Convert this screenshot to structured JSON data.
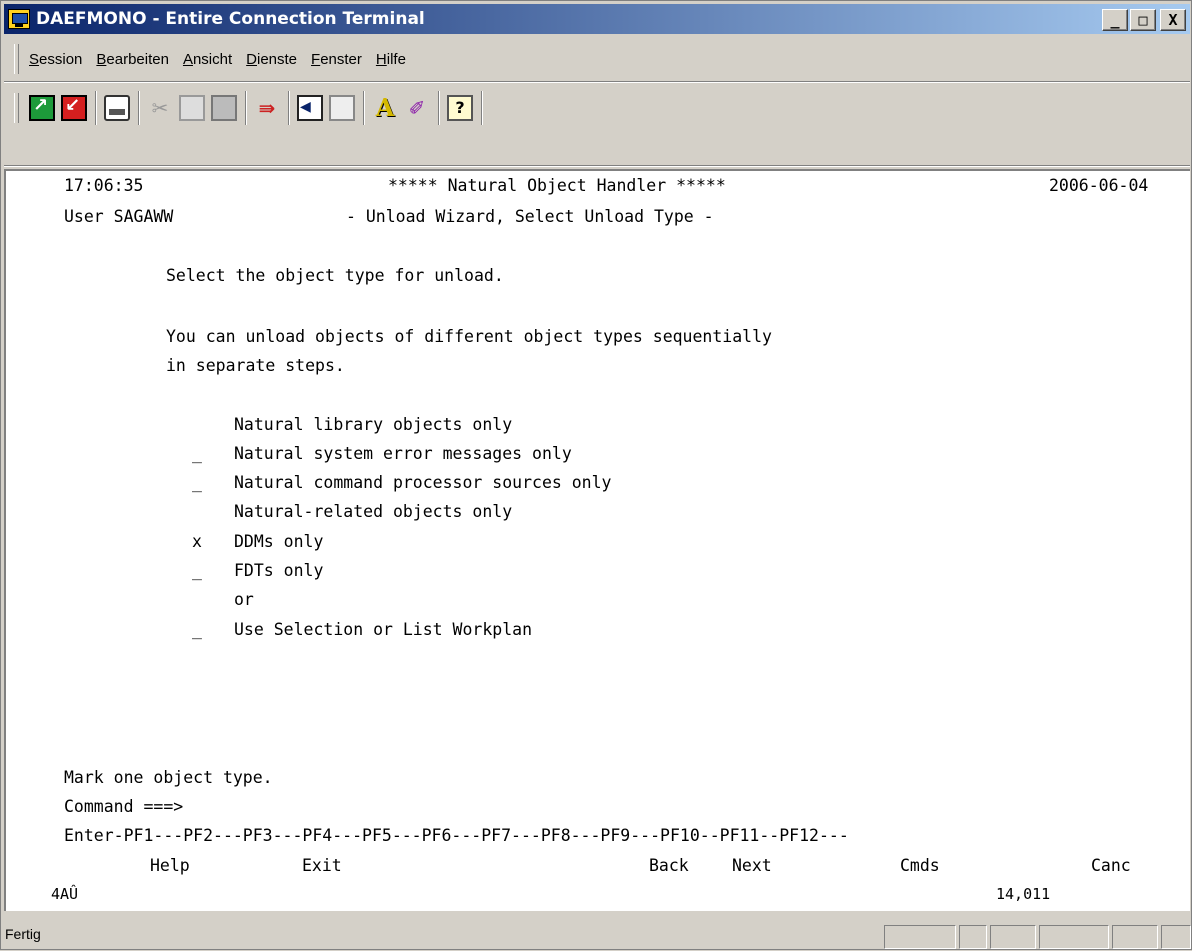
{
  "window": {
    "title": "DAEFMONO - Entire Connection Terminal",
    "minimize": "_",
    "maximize": "□",
    "close": "X"
  },
  "menu": {
    "items": [
      {
        "first": "S",
        "rest": "ession"
      },
      {
        "first": "B",
        "rest": "earbeiten"
      },
      {
        "first": "A",
        "rest": "nsicht"
      },
      {
        "first": "D",
        "rest": "ienste"
      },
      {
        "first": "F",
        "rest": "enster"
      },
      {
        "first": "H",
        "rest": "ilfe"
      }
    ]
  },
  "toolbar": {
    "icons": [
      "connect-icon",
      "disconnect-icon",
      "print-icon",
      "cut-icon",
      "copy-icon",
      "paste-icon",
      "transfer-icon",
      "send-icon",
      "receive-icon",
      "font-icon",
      "color-icon",
      "help-icon"
    ]
  },
  "terminal": {
    "time": "17:06:35",
    "header_title": "***** Natural Object Handler *****",
    "date": "2006-06-04",
    "user": "User SAGAWW",
    "subtitle": "- Unload Wizard, Select Unload Type -",
    "instruction1": "Select the object type for unload.",
    "instruction2": "You can unload objects of different object types sequentially",
    "instruction3": "in separate steps.",
    "options": [
      {
        "field": " ",
        "label": "Natural library objects only"
      },
      {
        "field": "_",
        "label": "Natural system error messages only"
      },
      {
        "field": "_",
        "label": "Natural command processor sources only"
      },
      {
        "field": " ",
        "label": "Natural-related objects only"
      },
      {
        "field": "x",
        "label": "DDMs only"
      },
      {
        "field": "_",
        "label": "FDTs only"
      },
      {
        "field": " ",
        "label": "or"
      },
      {
        "field": "_",
        "label": "Use Selection or List Workplan"
      }
    ],
    "message": "Mark one object type.",
    "command_prompt": "Command ===>",
    "pf_line": "Enter-PF1---PF2---PF3---PF4---PF5---PF6---PF7---PF8---PF9---PF10--PF11--PF12---",
    "pf_labels": {
      "help": "Help",
      "exit": "Exit",
      "back": "Back",
      "next": "Next",
      "cmds": "Cmds",
      "canc": "Canc"
    },
    "oia_left": "4AÛ",
    "cursor_pos": "14,011"
  },
  "status": {
    "text": "Fertig"
  }
}
